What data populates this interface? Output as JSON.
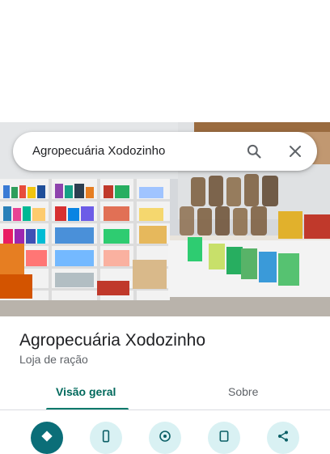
{
  "search": {
    "query": "Agropecuária Xodozinho"
  },
  "place": {
    "name": "Agropecuária Xodozinho",
    "category": "Loja de ração"
  },
  "tabs": [
    {
      "label": "Visão geral",
      "selected": true
    },
    {
      "label": "Sobre",
      "selected": false
    }
  ],
  "actions": [
    {
      "icon": "directions-icon"
    },
    {
      "icon": "phone-icon"
    },
    {
      "icon": "website-icon"
    },
    {
      "icon": "save-icon"
    },
    {
      "icon": "share-icon"
    }
  ],
  "colors": {
    "accent": "#00796b",
    "primary_action": "#0b6e78",
    "action_bg": "#d9f1f3"
  }
}
